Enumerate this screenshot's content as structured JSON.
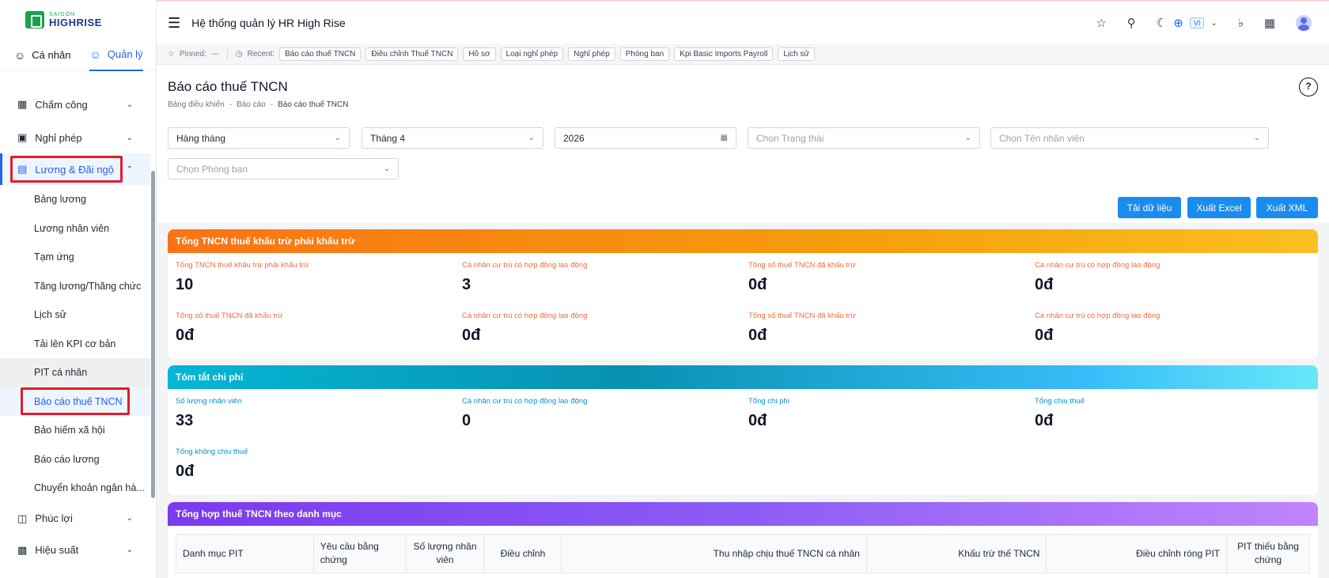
{
  "logo": {
    "small": "SAIGON",
    "big": "HIGHRISE"
  },
  "sidebar": {
    "tabs": [
      {
        "label": "Cá nhân",
        "icon": "user-icon"
      },
      {
        "label": "Quản lý",
        "icon": "user-icon"
      }
    ],
    "menu": {
      "cham_cong": "Chấm công",
      "nghi_phep": "Nghỉ phép",
      "luong": "Lương & Đãi ngộ",
      "sub": [
        "Bảng lương",
        "Lương nhân viên",
        "Tạm ứng",
        "Tăng lương/Thăng chức",
        "Lịch sử",
        "Tải lên KPI cơ bản",
        "PIT cá nhân",
        "Báo cáo thuế TNCN",
        "Bảo hiểm xã hội",
        "Báo cáo lương",
        "Chuyển khoản ngân hà..."
      ],
      "phuc_loi": "Phúc lợi",
      "hieu_suat": "Hiệu suất"
    }
  },
  "header": {
    "title": "Hệ thống quản lý HR High Rise",
    "lang": "VI"
  },
  "pinbar": {
    "pinned_label": "Pinned:",
    "pinned_value": "---",
    "recent_label": "Recent:",
    "chips": [
      "Báo cáo thuế TNCN",
      "Điều chỉnh Thuế TNCN",
      "Hồ sơ",
      "Loại nghỉ phép",
      "Nghỉ phép",
      "Phòng ban",
      "Kpi Basic Imports Payroll",
      "Lịch sử"
    ]
  },
  "page": {
    "title": "Báo cáo thuế TNCN",
    "breadcrumb": [
      "Bảng điều khiển",
      "Báo cáo",
      "Báo cáo thuế TNCN"
    ]
  },
  "filters": {
    "period": "Hàng tháng",
    "month": "Tháng 4",
    "year": "2026",
    "status_ph": "Chọn Trạng thái",
    "employee_ph": "Chọn Tên nhân viên",
    "dept_ph": "Chọn Phòng ban"
  },
  "buttons": {
    "load": "Tải dữ liệu",
    "excel": "Xuất Excel",
    "xml": "Xuất XML"
  },
  "card1": {
    "title": "Tổng TNCN thuế khấu trừ phải khấu trừ",
    "stats": [
      {
        "label": "Tổng TNCN thuế khấu trừ phải khấu trừ",
        "value": "10"
      },
      {
        "label": "Cá nhân cư trú có hợp đồng lao động",
        "value": "3"
      },
      {
        "label": "Tổng số thuế TNCN đã khấu trừ",
        "value": "0đ"
      },
      {
        "label": "Cá nhân cư trú có hợp đồng lao động",
        "value": "0đ"
      },
      {
        "label": "Tổng số thuế TNCN đã khấu trừ",
        "value": "0đ"
      },
      {
        "label": "Cá nhân cư trú có hợp đồng lao động",
        "value": "0đ"
      },
      {
        "label": "Tổng số thuế TNCN đã khấu trừ",
        "value": "0đ"
      },
      {
        "label": "Cá nhân cư trú có hợp đồng lao động",
        "value": "0đ"
      }
    ]
  },
  "card2": {
    "title": "Tóm tắt chi phí",
    "stats": [
      {
        "label": "Số lượng nhân viên",
        "value": "33"
      },
      {
        "label": "Cá nhân cư trú có hợp đồng lao động",
        "value": "0"
      },
      {
        "label": "Tổng chi phí",
        "value": "0đ"
      },
      {
        "label": "Tổng chịu thuế",
        "value": "0đ"
      },
      {
        "label": "Tổng không chịu thuế",
        "value": "0đ"
      }
    ]
  },
  "card3": {
    "title": "Tổng hợp thuế TNCN theo danh mục",
    "columns": [
      "Danh mục PIT",
      "Yêu cầu bằng chứng",
      "Số lượng nhân viên",
      "Điều chỉnh",
      "Thu nhập chịu thuế TNCN cá nhân",
      "Khấu trừ thế TNCN",
      "Điều chỉnh ròng PIT",
      "PIT thiếu bằng chứng"
    ]
  }
}
